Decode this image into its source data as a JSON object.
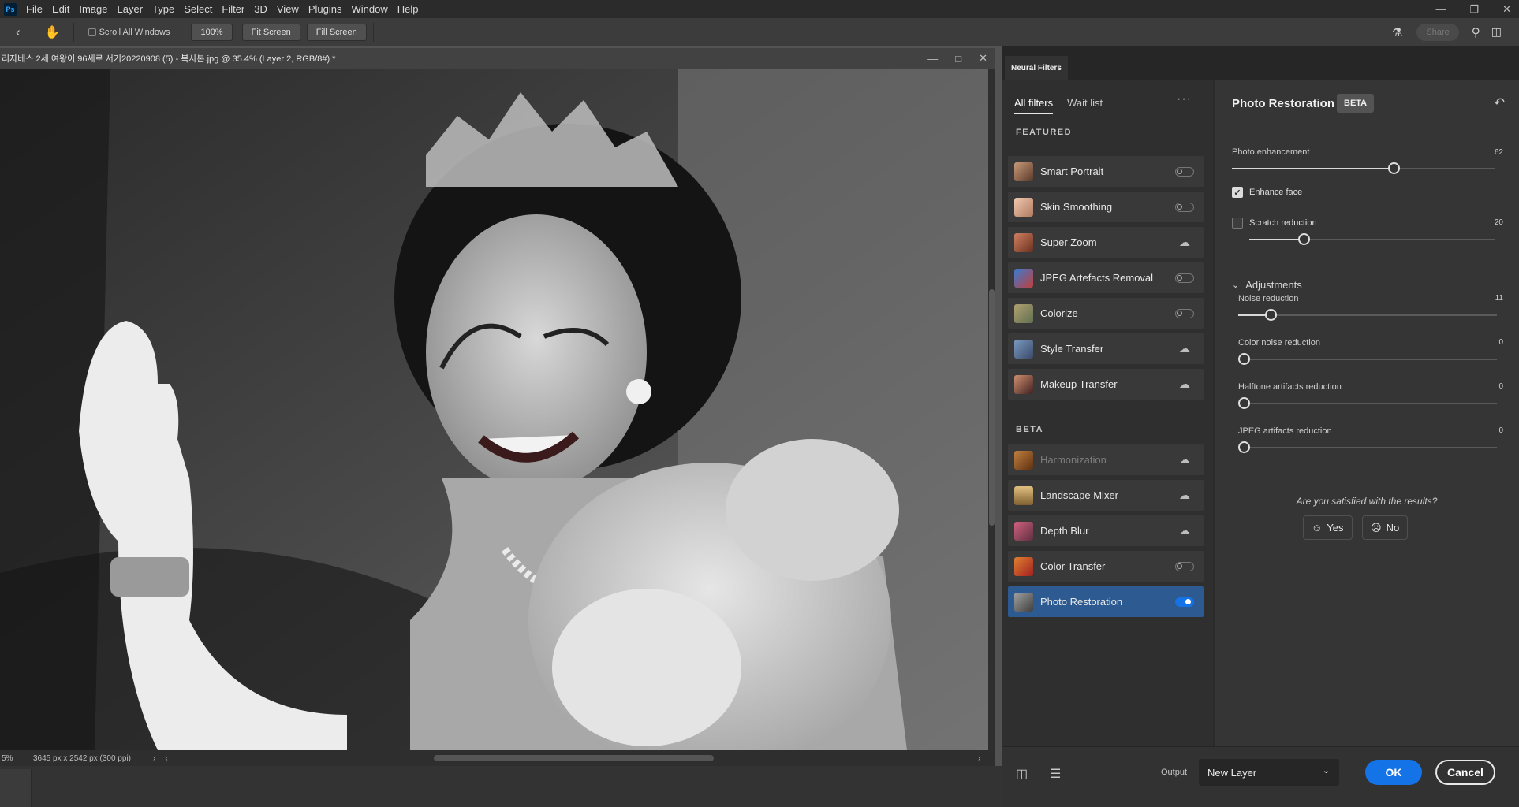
{
  "app": {
    "menu": [
      "File",
      "Edit",
      "Image",
      "Layer",
      "Type",
      "Select",
      "Filter",
      "3D",
      "View",
      "Plugins",
      "Window",
      "Help"
    ]
  },
  "options_bar": {
    "scroll_all_windows": "Scroll All Windows",
    "zoom_100": "100%",
    "fit_screen": "Fit Screen",
    "fill_screen": "Fill Screen",
    "share": "Share"
  },
  "document": {
    "tab_title": "리자베스 2세 여왕이 96세로 서거20220908 (5) - 복사본.jpg @ 35.4% (Layer 2, RGB/8#) *",
    "zoom_readout": "5%",
    "dimensions": "3645 px x 2542 px (300 ppi)"
  },
  "neural_filters": {
    "panel_tab": "Neural Filters",
    "list_tabs": [
      "All filters",
      "Wait list"
    ],
    "featured_label": "FEATURED",
    "beta_label": "BETA",
    "featured": [
      {
        "name": "Smart Portrait",
        "control": "toggle-off"
      },
      {
        "name": "Skin Smoothing",
        "control": "toggle-off"
      },
      {
        "name": "Super Zoom",
        "control": "cloud-download"
      },
      {
        "name": "JPEG Artefacts Removal",
        "control": "toggle-off"
      },
      {
        "name": "Colorize",
        "control": "toggle-off"
      },
      {
        "name": "Style Transfer",
        "control": "cloud-download"
      },
      {
        "name": "Makeup Transfer",
        "control": "cloud-download"
      }
    ],
    "beta": [
      {
        "name": "Harmonization",
        "control": "cloud-download",
        "disabled": true
      },
      {
        "name": "Landscape Mixer",
        "control": "cloud-download"
      },
      {
        "name": "Depth Blur",
        "control": "cloud-download"
      },
      {
        "name": "Color Transfer",
        "control": "toggle-off"
      },
      {
        "name": "Photo Restoration",
        "control": "toggle-on",
        "selected": true
      }
    ]
  },
  "details": {
    "title": "Photo Restoration",
    "badge": "BETA",
    "photo_enhancement": {
      "label": "Photo enhancement",
      "value": "62"
    },
    "enhance_face": {
      "label": "Enhance face",
      "checked": true
    },
    "scratch_reduction": {
      "label": "Scratch reduction",
      "value": "20",
      "checked": false
    },
    "adjustments_header": "Adjustments",
    "noise_reduction": {
      "label": "Noise reduction",
      "value": "11"
    },
    "color_noise_reduction": {
      "label": "Color noise reduction",
      "value": "0"
    },
    "halftone_artifacts_reduction": {
      "label": "Halftone artifacts reduction",
      "value": "0"
    },
    "jpeg_artifacts_reduction": {
      "label": "JPEG artifacts reduction",
      "value": "0"
    },
    "satisfied_question": "Are you satisfied with the results?",
    "yes": "Yes",
    "no": "No"
  },
  "footer": {
    "output_label": "Output",
    "output_value": "New Layer",
    "ok": "OK",
    "cancel": "Cancel"
  },
  "colors": {
    "accent": "#1473e6",
    "selected_row": "#2d5a91"
  }
}
